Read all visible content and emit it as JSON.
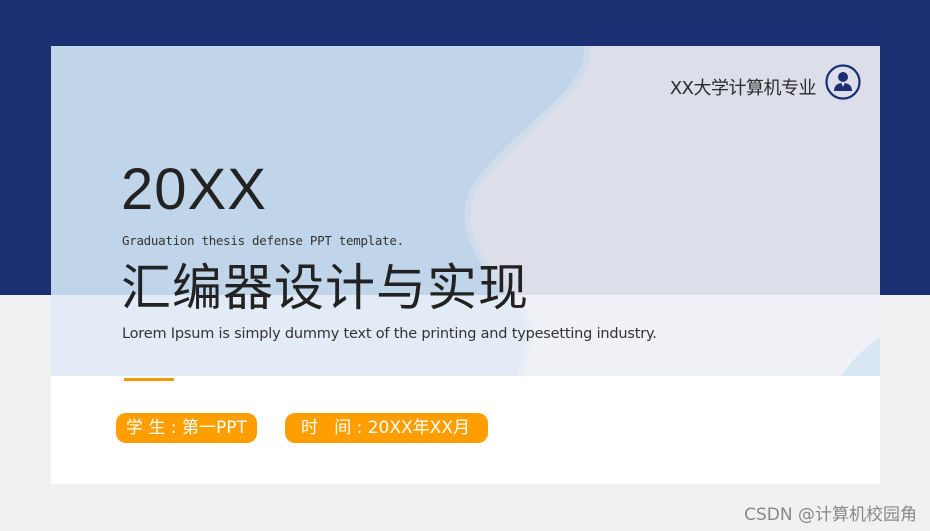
{
  "slide": {
    "school": "XX大学计算机专业",
    "year": "20XX",
    "subtitle_en": "Graduation thesis defense PPT template.",
    "title_cn": "汇编器设计与实现",
    "lorem": "Lorem Ipsum is simply dummy text of the printing and typesetting industry.",
    "student_label": "学 生 : 第一PPT",
    "time_label": "时   间 : 20XX年XX月"
  },
  "watermark": "CSDN @计算机校园角",
  "icons": {
    "profile": "user-avatar-icon"
  },
  "colors": {
    "navy_band": "#1b2f73",
    "light_blue": "#c0d4ea",
    "lavender": "#dddfea",
    "accent_orange": "#ff9e00"
  }
}
